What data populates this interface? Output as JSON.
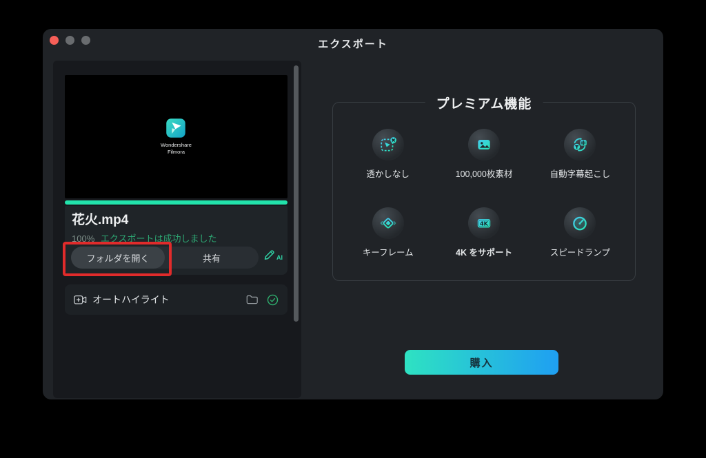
{
  "window": {
    "title": "エクスポート"
  },
  "preview": {
    "logo_line1": "Wondershare",
    "logo_line2": "Filmora",
    "filename": "花火.mp4",
    "progress_percent": "100%",
    "status_text": "エクスポートは成功しました",
    "open_folder_label": "フォルダを開く",
    "share_label": "共有",
    "ai_label": "AI"
  },
  "auto_highlight": {
    "label": "オートハイライト"
  },
  "premium": {
    "title": "プレミアム機能",
    "features": [
      {
        "label": "透かしなし",
        "icon": "watermark-off-icon"
      },
      {
        "label": "100,000枚素材",
        "icon": "stock-media-icon"
      },
      {
        "label": "自動字幕起こし",
        "icon": "auto-caption-icon"
      },
      {
        "label": "キーフレーム",
        "icon": "keyframe-icon"
      },
      {
        "label": "4K をサポート",
        "icon": "4k-support-icon"
      },
      {
        "label": "スピードランプ",
        "icon": "speed-ramp-icon"
      }
    ],
    "buy_label": "購入"
  },
  "colors": {
    "accent_teal": "#22e2ab",
    "success_green": "#2da572",
    "annotation_red": "#e12b2b",
    "buy_gradient_start": "#2ee2c2",
    "buy_gradient_end": "#1f9ff2"
  }
}
